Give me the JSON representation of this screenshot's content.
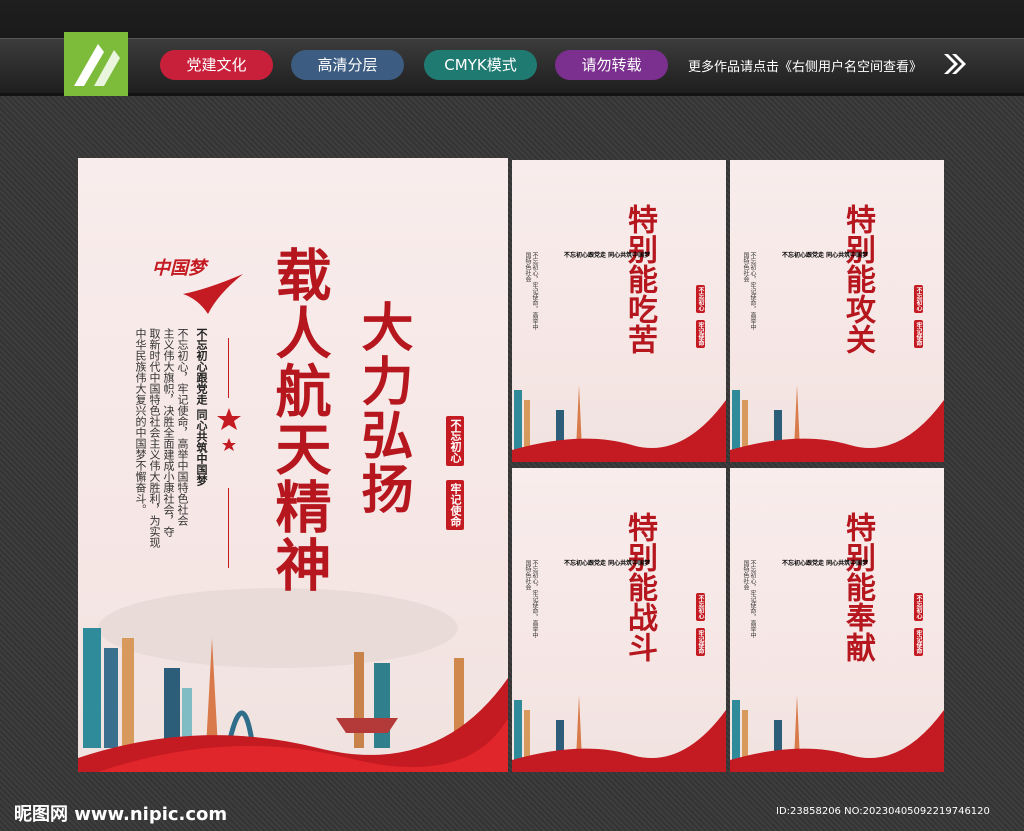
{
  "header": {
    "tags": [
      "党建文化",
      "高清分层",
      "CMYK模式",
      "请勿转载"
    ],
    "more_text": "更多作品请点击《右侧用户名空间查看》"
  },
  "main_poster": {
    "title_right": "大力弘扬",
    "title_left": "载人航天精神",
    "seal_1": "不忘初心",
    "seal_2": "牢记使命",
    "logo_text": "中国梦",
    "lead": "不忘初心跟党走 同心共筑中国梦",
    "body": [
      "不忘初心，牢记使命，高举中国特色社会",
      "主义伟大旗帜，决胜全面建成小康社会，夺",
      "取新时代中国特色社会主义伟大胜利，为实现",
      "中华民族伟大复兴的中国梦不懈奋斗。"
    ]
  },
  "small_posters": [
    {
      "title": "特别能吃苦"
    },
    {
      "title": "特别能攻关"
    },
    {
      "title": "特别能战斗"
    },
    {
      "title": "特别能奉献"
    }
  ],
  "footer": {
    "site": "昵图网 www.nipic.com",
    "id_text": "ID:23858206 NO:20230405092219746120"
  }
}
